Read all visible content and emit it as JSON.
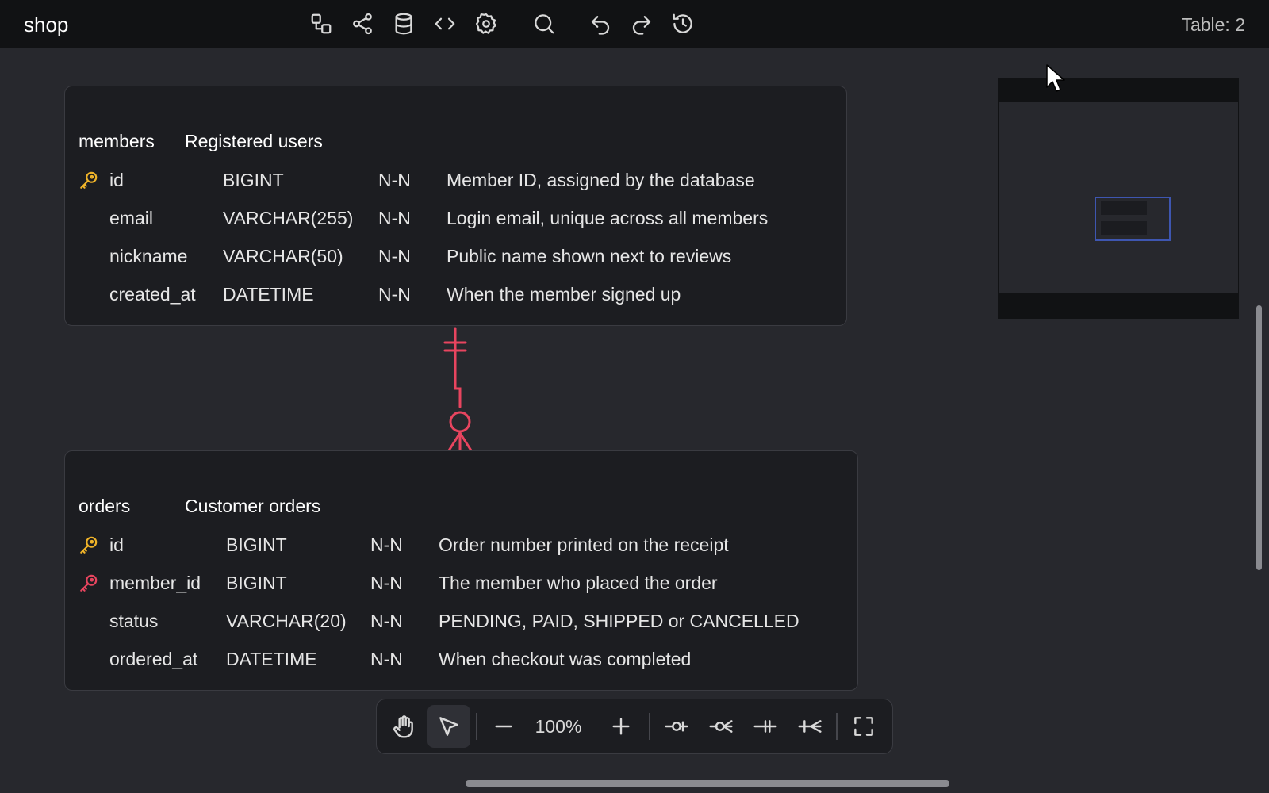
{
  "app": {
    "title": "shop",
    "table_count": "Table: 2"
  },
  "toolbar": {
    "icons": [
      "diagram-icon",
      "share-icon",
      "database-icon",
      "code-icon",
      "settings-icon",
      "search-icon",
      "undo-icon",
      "redo-icon",
      "history-icon"
    ]
  },
  "tables": [
    {
      "name": "members",
      "comment": "Registered users",
      "fields": [
        {
          "key": "primary",
          "name": "id",
          "type": "BIGINT",
          "nullable": "N-N",
          "comment": "Member ID, assigned by the database"
        },
        {
          "key": "",
          "name": "email",
          "type": "VARCHAR(255)",
          "nullable": "N-N",
          "comment": "Login email, unique across all members"
        },
        {
          "key": "",
          "name": "nickname",
          "type": "VARCHAR(50)",
          "nullable": "N-N",
          "comment": "Public name shown next to reviews"
        },
        {
          "key": "",
          "name": "created_at",
          "type": "DATETIME",
          "nullable": "N-N",
          "comment": "When the member signed up"
        }
      ]
    },
    {
      "name": "orders",
      "comment": "Customer orders",
      "fields": [
        {
          "key": "primary",
          "name": "id",
          "type": "BIGINT",
          "nullable": "N-N",
          "comment": "Order number printed on the receipt"
        },
        {
          "key": "foreign",
          "name": "member_id",
          "type": "BIGINT",
          "nullable": "N-N",
          "comment": "The member who placed the order"
        },
        {
          "key": "",
          "name": "status",
          "type": "VARCHAR(20)",
          "nullable": "N-N",
          "comment": "PENDING, PAID, SHIPPED or CANCELLED"
        },
        {
          "key": "",
          "name": "ordered_at",
          "type": "DATETIME",
          "nullable": "N-N",
          "comment": "When checkout was completed"
        }
      ]
    }
  ],
  "relationship": {
    "from": "members.id",
    "to": "orders.member_id",
    "cardinality": "one-to-zero-or-many",
    "color": "#e8455f"
  },
  "zoom": {
    "level": "100%"
  },
  "colors": {
    "primary_key": "#f0b429",
    "foreign_key": "#e8455f",
    "viewport": "#3e56b0",
    "background": "#27282d",
    "topbar": "#111214"
  }
}
